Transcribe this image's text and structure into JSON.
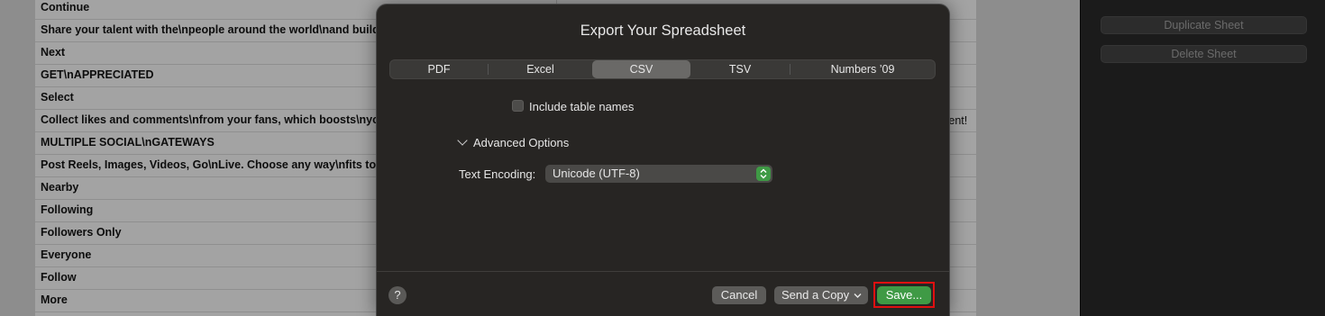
{
  "sheet": {
    "rows": [
      "Continue",
      "Share your talent with the\\npeople around the world\\nand build",
      "Next",
      "GET\\nAPPRECIATED",
      "Select",
      "Collect likes and comments\\nfrom your fans, which boosts\\nyo",
      "MULTIPLE SOCIAL\\nGATEWAYS",
      "Post Reels, Images, Videos, Go\\nLive. Choose any way\\nfits to",
      "Nearby",
      "Following",
      "Followers Only",
      "Everyone",
      "Follow",
      "More"
    ],
    "overflow_right_1": "ontent!",
    "overflow_right_2": "!"
  },
  "inspector": {
    "duplicate_label": "Duplicate Sheet",
    "delete_label": "Delete Sheet"
  },
  "dialog": {
    "title": "Export Your Spreadsheet",
    "tabs": [
      "PDF",
      "Excel",
      "CSV",
      "TSV",
      "Numbers ’09"
    ],
    "active_tab": "CSV",
    "include_table_names_label": "Include table names",
    "include_table_names_checked": false,
    "advanced_label": "Advanced Options",
    "encoding_label": "Text Encoding:",
    "encoding_value": "Unicode (UTF-8)",
    "help_label": "?",
    "cancel_label": "Cancel",
    "send_copy_label": "Send a Copy",
    "save_label": "Save..."
  },
  "colors": {
    "accent": "#3f9a45",
    "highlight": "#e01010"
  }
}
